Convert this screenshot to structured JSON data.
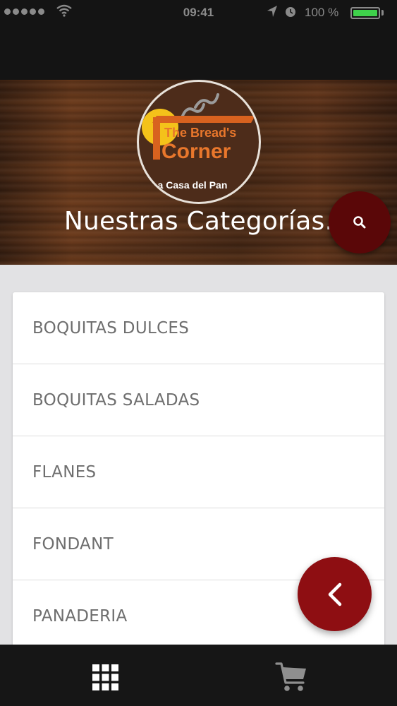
{
  "status_bar": {
    "time": "09:41",
    "battery_percent": "100 %",
    "battery_level": 1.0,
    "icons": [
      "signal-dots-icon",
      "wifi-icon",
      "location-arrow-icon",
      "alarm-clock-icon",
      "battery-icon"
    ]
  },
  "header": {
    "logo": {
      "line1": "The Bread's",
      "line2": "Corner",
      "tagline": "La Casa del Pan"
    },
    "title": "Nuestras Categorías.",
    "search_icon": "search-icon"
  },
  "categories": [
    {
      "label": "BOQUITAS DULCES"
    },
    {
      "label": "BOQUITAS SALADAS"
    },
    {
      "label": "FLANES"
    },
    {
      "label": "FONDANT"
    },
    {
      "label": "PANADERIA"
    }
  ],
  "back_button_icon": "chevron-left-icon",
  "tab_bar": {
    "tabs": [
      {
        "icon": "grid-icon"
      },
      {
        "icon": "cart-icon"
      }
    ]
  },
  "colors": {
    "accent": "#8e0e12",
    "search_button": "#5a0708",
    "bars": "#141414",
    "battery": "#3fd14b",
    "logo_orange": "#e9772c",
    "logo_sun": "#f4c21a"
  }
}
